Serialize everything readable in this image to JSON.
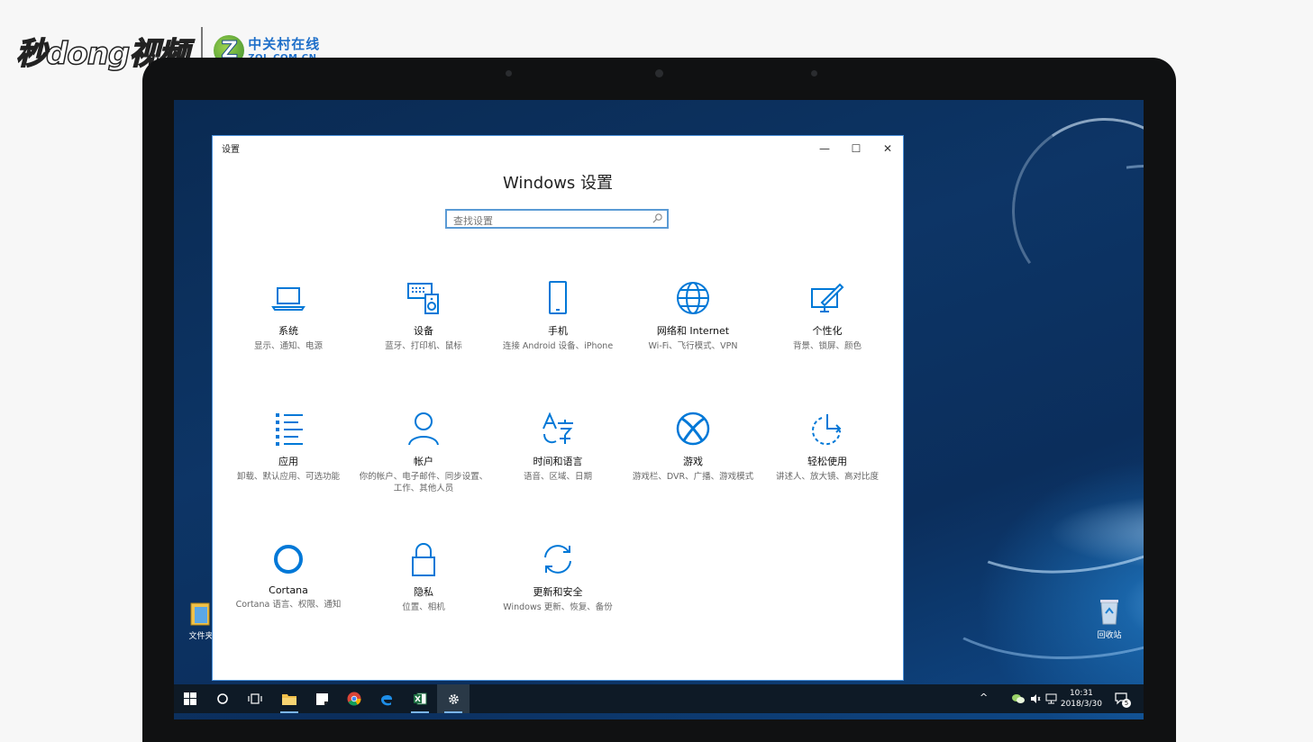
{
  "watermark": {
    "brand": "秒dong视频",
    "zol_cn": "中关村在线",
    "zol_en": "ZOL.COM.CN",
    "zol_logo_letter": "Z"
  },
  "window": {
    "title": "设置",
    "heading": "Windows 设置",
    "controls": {
      "minimize": "—",
      "maximize": "☐",
      "close": "✕"
    },
    "search": {
      "placeholder": "查找设置"
    }
  },
  "tiles": [
    {
      "name": "系统",
      "desc": "显示、通知、电源",
      "icon": "laptop-icon"
    },
    {
      "name": "设备",
      "desc": "蓝牙、打印机、鼠标",
      "icon": "devices-icon"
    },
    {
      "name": "手机",
      "desc": "连接 Android 设备、iPhone",
      "icon": "phone-icon"
    },
    {
      "name": "网络和 Internet",
      "desc": "Wi-Fi、飞行模式、VPN",
      "icon": "globe-icon"
    },
    {
      "name": "个性化",
      "desc": "背景、锁屏、颜色",
      "icon": "personalize-icon"
    },
    {
      "name": "应用",
      "desc": "卸载、默认应用、可选功能",
      "icon": "apps-list-icon"
    },
    {
      "name": "帐户",
      "desc": "你的帐户、电子邮件、同步设置、工作、其他人员",
      "icon": "person-icon"
    },
    {
      "name": "时间和语言",
      "desc": "语音、区域、日期",
      "icon": "time-language-icon"
    },
    {
      "name": "游戏",
      "desc": "游戏栏、DVR、广播、游戏模式",
      "icon": "xbox-icon"
    },
    {
      "name": "轻松使用",
      "desc": "讲述人、放大镜、高对比度",
      "icon": "ease-of-access-icon"
    },
    {
      "name": "Cortana",
      "desc": "Cortana 语言、权限、通知",
      "icon": "cortana-icon"
    },
    {
      "name": "隐私",
      "desc": "位置、相机",
      "icon": "lock-icon"
    },
    {
      "name": "更新和安全",
      "desc": "Windows 更新、恢复、备份",
      "icon": "sync-icon"
    }
  ],
  "desktop": {
    "file_explorer_label": "文件夹",
    "recycle_bin_label": "回收站"
  },
  "taskbar": {
    "time": "10:31",
    "date": "2018/3/30",
    "notification_count": "5",
    "tray_chevron": "^"
  },
  "colors": {
    "accent": "#0078d7",
    "taskbar": "#0e1a26",
    "search_border": "#5b9bd5"
  }
}
